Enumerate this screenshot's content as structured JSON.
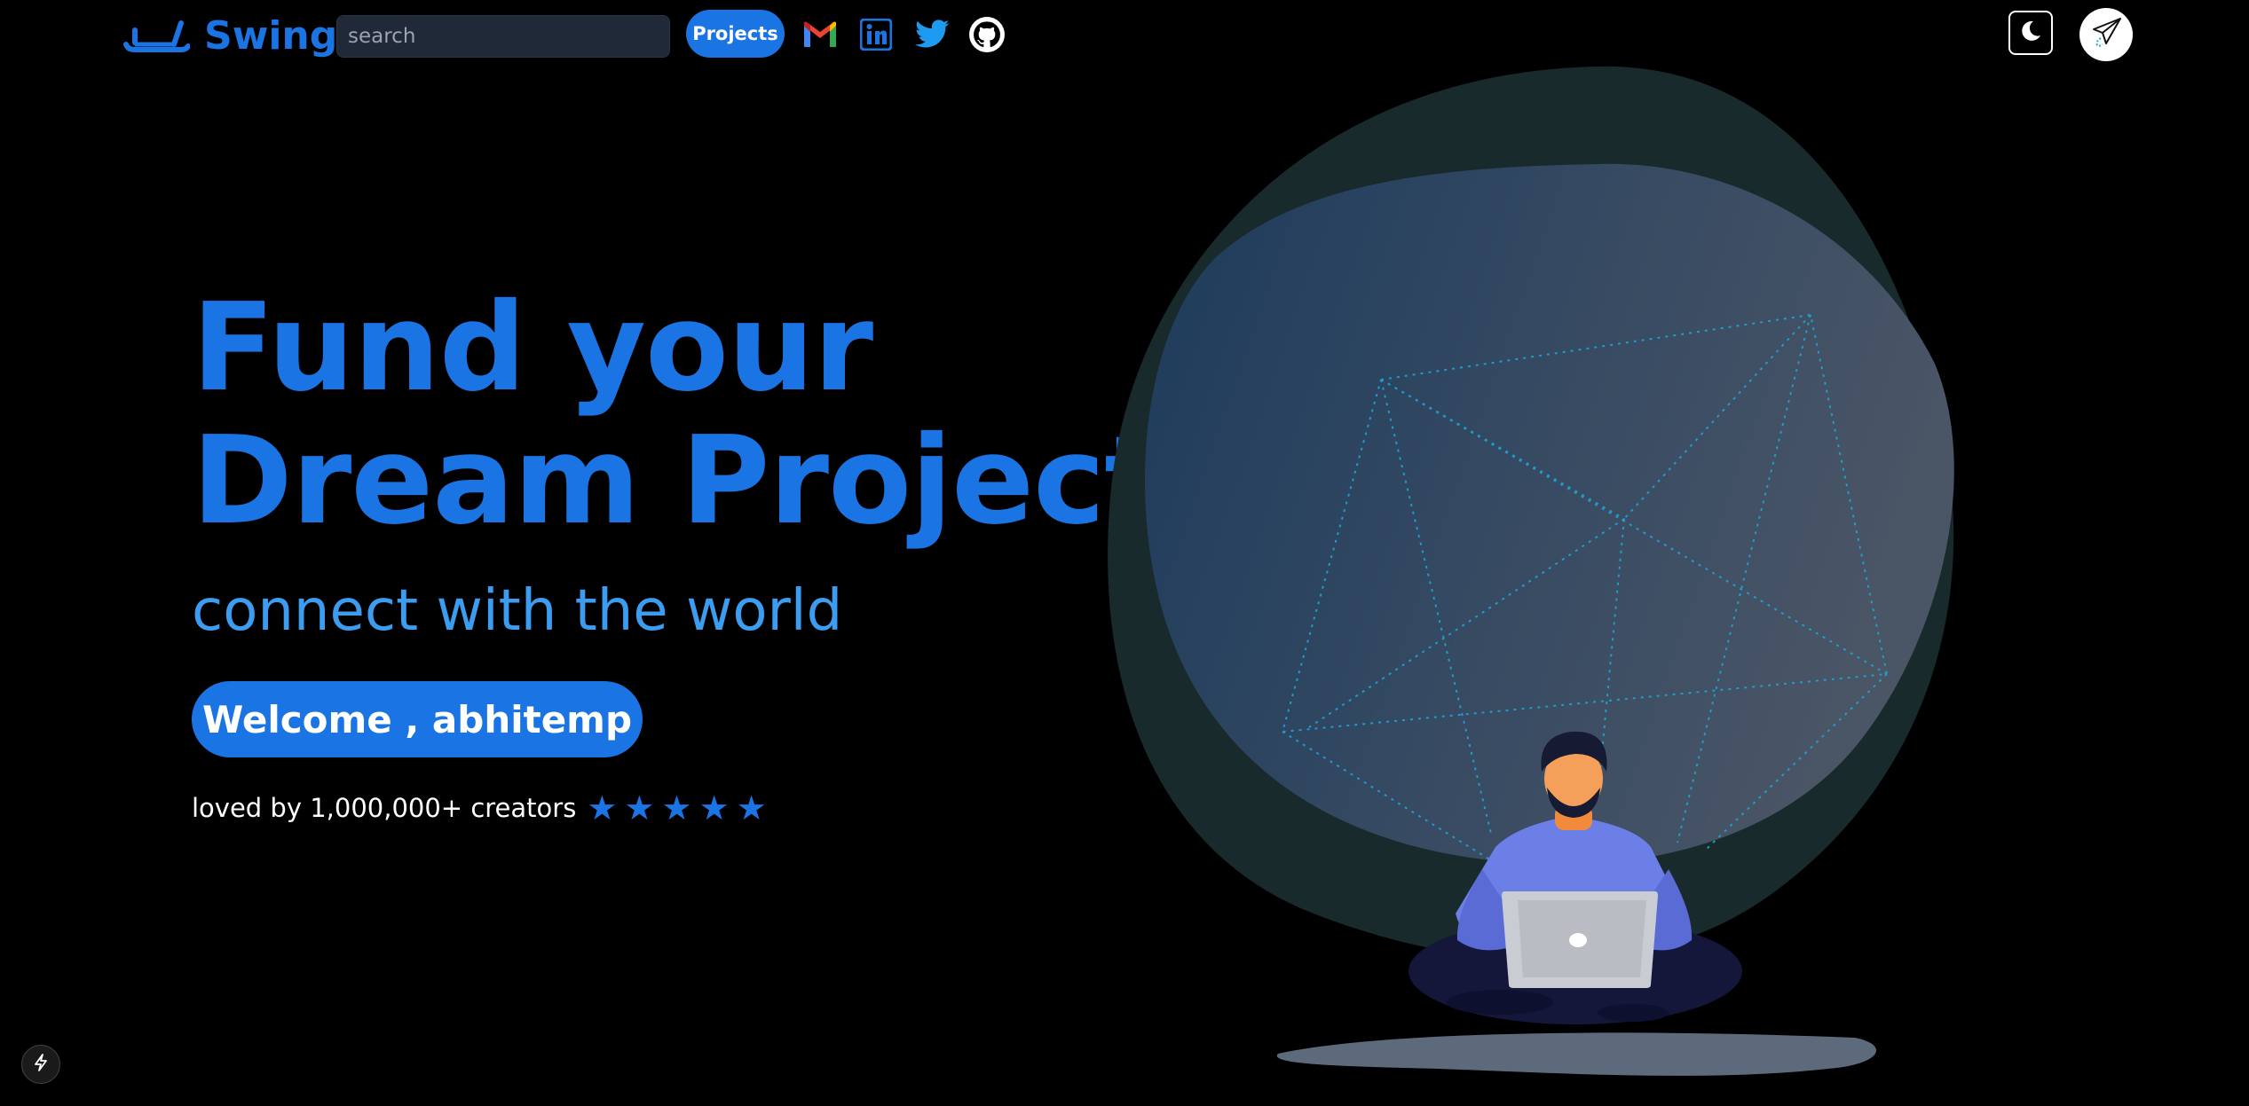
{
  "nav": {
    "brand": "Swing",
    "search_placeholder": "search",
    "projects_label": "Projects",
    "icons": [
      "logo-icon",
      "gmail-icon",
      "linkedin-icon",
      "twitter-icon",
      "github-icon",
      "moon-icon",
      "paper-plane-icon"
    ]
  },
  "hero": {
    "title_line1": "Fund your",
    "title_line2": "Dream Project",
    "subtitle": "connect with the world",
    "welcome_label": "Welcome , abhitemp",
    "loved_text": "loved by 1,000,000+ creators",
    "rating": 5
  },
  "colors": {
    "accent": "#1b74e4",
    "subtitle": "#3b9cf0",
    "background": "#000000"
  },
  "bottom_left_icon": "bolt-icon"
}
